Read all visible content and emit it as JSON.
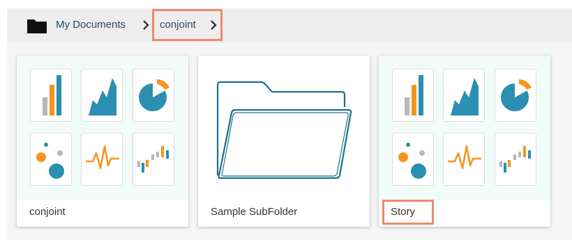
{
  "breadcrumb": {
    "home_icon": "folder-icon",
    "home_label": "My Documents",
    "current_label": "conjoint",
    "separator_icon": "chevron-right-icon"
  },
  "colors": {
    "accent_highlight": "#ee8a6a",
    "teal": "#2a8fb0",
    "orange": "#f7941d",
    "gray": "#b7b7b7",
    "folder_stroke": "#1d6f8c"
  },
  "cards": [
    {
      "label": "conjoint",
      "type": "dataset",
      "icons": [
        "bar-chart-icon",
        "area-chart-icon",
        "pie-chart-icon",
        "bubble-chart-icon",
        "line-chart-icon",
        "waterfall-chart-icon"
      ]
    },
    {
      "label": "Sample SubFolder",
      "type": "folder",
      "icons": [
        "folder-icon"
      ]
    },
    {
      "label": "Story",
      "type": "story",
      "icons": [
        "bar-chart-icon",
        "area-chart-icon",
        "pie-chart-icon",
        "bubble-chart-icon",
        "line-chart-icon",
        "waterfall-chart-icon"
      ]
    }
  ]
}
